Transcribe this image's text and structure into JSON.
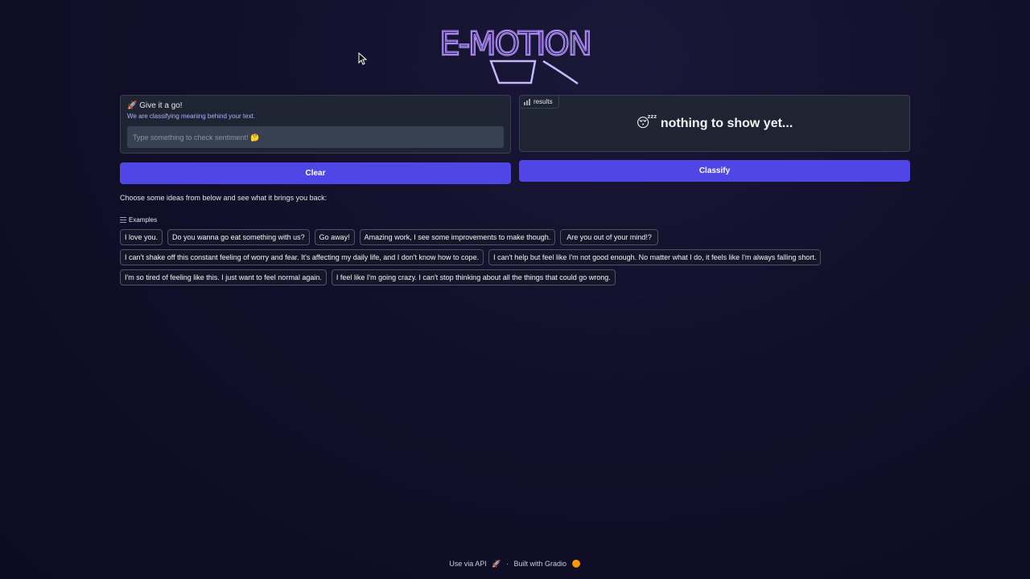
{
  "logo": {
    "text": "E-MOTION"
  },
  "input_panel": {
    "title": "🚀 Give it a go!",
    "subtitle": "We are classifying meaning behind your text.",
    "placeholder": "Type something to check sentiment! 🤔",
    "value": ""
  },
  "result_panel": {
    "label": "results",
    "text": "😴 nothing to show yet..."
  },
  "buttons": {
    "clear": "Clear",
    "classify": "Classify"
  },
  "hint": "Choose some ideas from below and see what it brings you back:",
  "examples": {
    "label": "Examples",
    "items": [
      "I love you.",
      "Do you wanna go eat something with us?",
      "Go away!",
      "Amazing work, I see some improvements to make though.",
      " Are you out of your mind!? ",
      "I can't shake off this constant feeling of worry and fear. It's affecting my daily life, and I don't know how to cope.",
      "I can't help but feel like I'm not good enough. No matter what I do, it feels like I'm always falling short.",
      "I'm so tired of feeling like this. I just want to feel normal again.",
      "I feel like I'm going crazy. I can't stop thinking about all the things that could go wrong."
    ]
  },
  "footer": {
    "api": "Use via API",
    "built": "Built with Gradio"
  },
  "colors": {
    "accent": "#4f46e5",
    "panel": "#1f2433",
    "background": "#120f2a"
  }
}
